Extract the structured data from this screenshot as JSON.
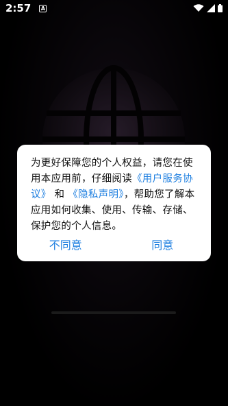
{
  "status_bar": {
    "time": "2:57",
    "notification_icon": "A",
    "icons": [
      "wifi-icon",
      "signal-icon",
      "battery-icon"
    ]
  },
  "dialog": {
    "text_before": "为更好保障您的个人权益，请您在使用本应用前，仔细阅读",
    "link_user_agreement": "《用户服务协议》",
    "text_and": "和",
    "link_privacy": "《隐私声明》",
    "text_after": "，帮助您了解本应用如何收集、使用、传输、存储、保护您的个人信息。",
    "disagree_label": "不同意",
    "agree_label": "同意"
  },
  "colors": {
    "link": "#1e7fe0",
    "background": "#000000",
    "dialog_bg": "#ffffff"
  }
}
